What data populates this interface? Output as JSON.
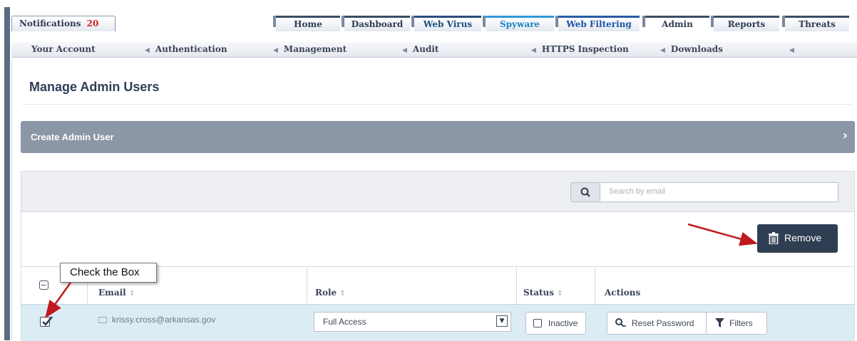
{
  "notifications": {
    "label": "Notifications",
    "count": "20"
  },
  "tabs": [
    {
      "label": "Home"
    },
    {
      "label": "Dashboard"
    },
    {
      "label": "Web Virus"
    },
    {
      "label": "Spyware"
    },
    {
      "label": "Web Filtering"
    },
    {
      "label": "Admin"
    },
    {
      "label": "Reports"
    },
    {
      "label": "Threats"
    }
  ],
  "subnav": [
    {
      "label": "Your Account"
    },
    {
      "label": "Authentication"
    },
    {
      "label": "Management"
    },
    {
      "label": "Audit"
    },
    {
      "label": "HTTPS Inspection"
    },
    {
      "label": "Downloads"
    }
  ],
  "page": {
    "title": "Manage Admin Users"
  },
  "create_bar": {
    "label": "Create Admin User"
  },
  "search": {
    "placeholder": "Search by email"
  },
  "remove_button": {
    "label": "Remove"
  },
  "table": {
    "headers": {
      "email": "Email",
      "role": "Role",
      "status": "Status",
      "actions": "Actions"
    },
    "rows": [
      {
        "email": "krissy.cross@arkansas.gov",
        "role": "Full Access",
        "status": "Inactive",
        "reset_label": "Reset Password",
        "filters_label": "Filters",
        "checked": true
      }
    ]
  },
  "annotation": {
    "callout": "Check the Box",
    "arrow_color": "#c0191f"
  },
  "colors": {
    "header_dark": "#2f3e52",
    "create_bar": "#8b97a7",
    "row_highlight": "#dcecf4"
  }
}
